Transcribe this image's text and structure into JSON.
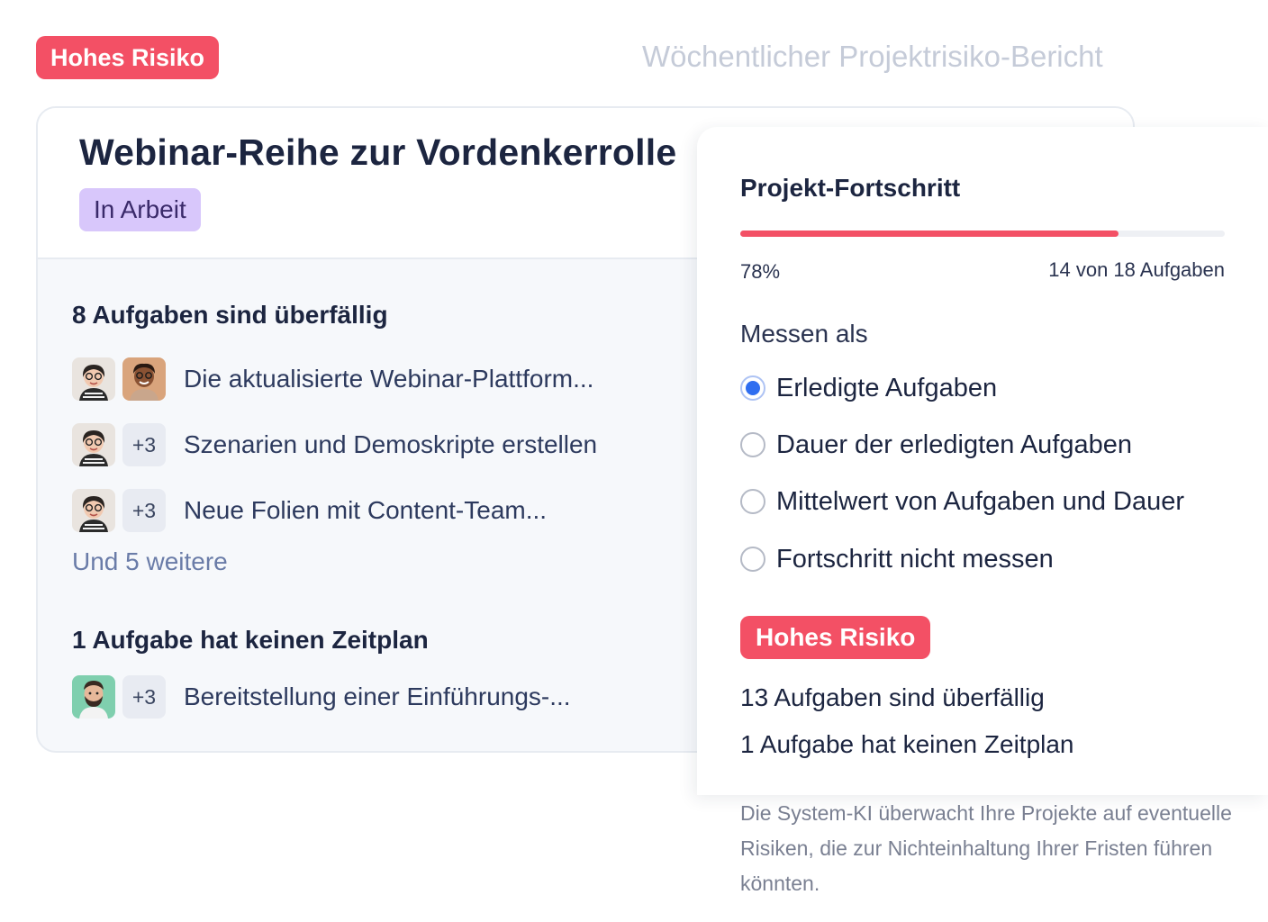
{
  "header": {
    "risk_badge": "Hohes Risiko",
    "report_title": "Wöchentlicher Projektrisiko-Bericht"
  },
  "project": {
    "title": "Webinar-Reihe zur Vordenkerrolle",
    "status": "In Arbeit"
  },
  "overdue": {
    "heading": "8 Aufgaben sind überfällig",
    "tasks": [
      {
        "text": "Die aktualisierte Webinar-Plattform...",
        "extra": ""
      },
      {
        "text": "Szenarien und Demoskripte erstellen",
        "extra": "+3"
      },
      {
        "text": "Neue Folien mit Content-Team...",
        "extra": "+3"
      }
    ],
    "more": "Und 5 weitere"
  },
  "unscheduled": {
    "heading": "1 Aufgabe hat keinen Zeitplan",
    "tasks": [
      {
        "text": "Bereitstellung einer Einführungs-...",
        "extra": "+3"
      }
    ]
  },
  "progress": {
    "title": "Projekt-Fortschritt",
    "percent_label": "78%",
    "fraction": 0.78,
    "count_label": "14 von 18 Aufgaben",
    "bar_color": "#f35065"
  },
  "measure": {
    "label": "Messen als",
    "options": [
      {
        "label": "Erledigte Aufgaben",
        "selected": true
      },
      {
        "label": "Dauer der erledigten Aufgaben",
        "selected": false
      },
      {
        "label": "Mittelwert von Aufgaben und Dauer",
        "selected": false
      },
      {
        "label": "Fortschritt nicht messen",
        "selected": false
      }
    ]
  },
  "risk": {
    "badge": "Hohes Risiko",
    "lines": [
      "13 Aufgaben sind überfällig",
      "1 Aufgabe hat keinen Zeitplan"
    ]
  },
  "footnote": "Die System-KI überwacht Ihre Projekte auf eventuelle Risiken, die zur Nichteinhaltung Ihrer Fristen führen könnten.",
  "colors": {
    "risk_red": "#f35065",
    "status_purple": "#d8c7fb",
    "radio_blue": "#2f6ef0"
  }
}
